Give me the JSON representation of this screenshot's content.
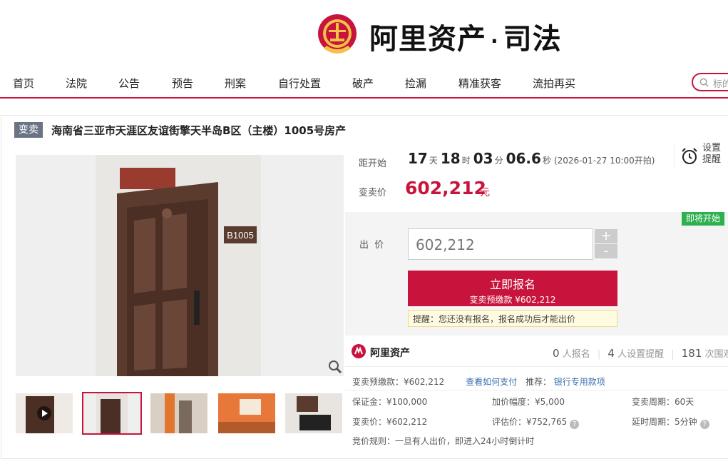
{
  "brand": {
    "name": "阿里资产",
    "dot": "·",
    "suffix": "司法"
  },
  "nav": [
    "首页",
    "法院",
    "公告",
    "预告",
    "刑案",
    "自行处置",
    "破产",
    "捡漏",
    "精准获客",
    "流拍再买"
  ],
  "search": {
    "placeholder": "标的"
  },
  "lot": {
    "tag": "变卖",
    "title": "海南省三亚市天涯区友谊街擎天半岛B区（主楼）1005号房产",
    "countdown_label": "距开始",
    "days": "17",
    "days_unit": "天",
    "hours": "18",
    "hours_unit": "时",
    "minutes": "03",
    "minutes_unit": "分",
    "seconds": "06.6",
    "seconds_unit": "秒",
    "start_note": "(2026-01-27 10:00开拍)",
    "remind_label_1": "设置",
    "remind_label_2": "提醒",
    "price_label": "变卖价",
    "price": "602,212",
    "price_unit": "元",
    "soon_badge": "即将开始",
    "bid_label": "出  价",
    "bid_value": "602,212",
    "plus": "+",
    "minus": "-",
    "apply_label": "立即报名",
    "apply_sub": "变卖预缴款 ¥602,212",
    "hint": "提醒：您还没有报名，报名成功后才能出价"
  },
  "photo": {
    "sign_plate": "B1005"
  },
  "ali": {
    "logo": "阿里资产",
    "signups": "0",
    "signups_label": "人报名",
    "reminders": "4",
    "reminders_label": "人设置提醒",
    "views": "181",
    "views_label": "次围观"
  },
  "details": {
    "deposit_label": "变卖预缴款：¥602,212",
    "how_pay": "查看如何支付",
    "recommend_label": "推荐：",
    "bank_loan": "银行专用款项",
    "margin": "保证金：¥100,000",
    "increment": "加价幅度：¥5,000",
    "cycle": "变卖周期：60天",
    "sale_price": "变卖价：¥602,212",
    "appraisal": "评估价：¥752,765",
    "delay": "延时周期：5分钟",
    "rule": "竞价规则：一旦有人出价，即进入24小时倒计时"
  },
  "colors": {
    "accent": "#c8143c",
    "badge_green": "#2eb04e",
    "tag_gray": "#6b7485"
  }
}
